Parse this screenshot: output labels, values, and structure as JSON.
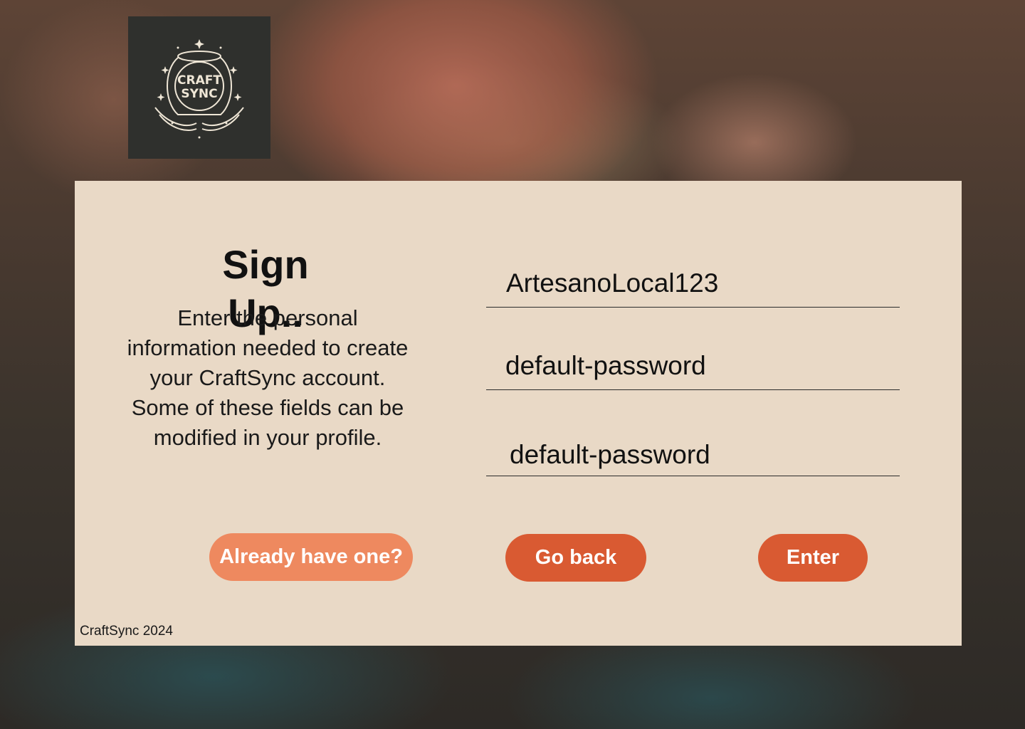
{
  "brand": {
    "logo_text_line1": "CRAFT",
    "logo_text_line2": "SYNC"
  },
  "signup": {
    "title": "Sign Up..",
    "description": "Enter the personal information needed to create your CraftSync account. Some of these fields can be modified in your profile."
  },
  "form": {
    "username_value": "ArtesanoLocal123",
    "password_value": "default-password",
    "confirm_password_value": "default-password"
  },
  "buttons": {
    "already_have_one": "Already have one?",
    "go_back": "Go back",
    "enter": "Enter"
  },
  "footer": {
    "copyright": "CraftSync 2024"
  },
  "colors": {
    "card_background": "#e9d9c6",
    "primary_button": "#d95a32",
    "secondary_button": "#ee895f",
    "logo_background": "#2f302d"
  }
}
